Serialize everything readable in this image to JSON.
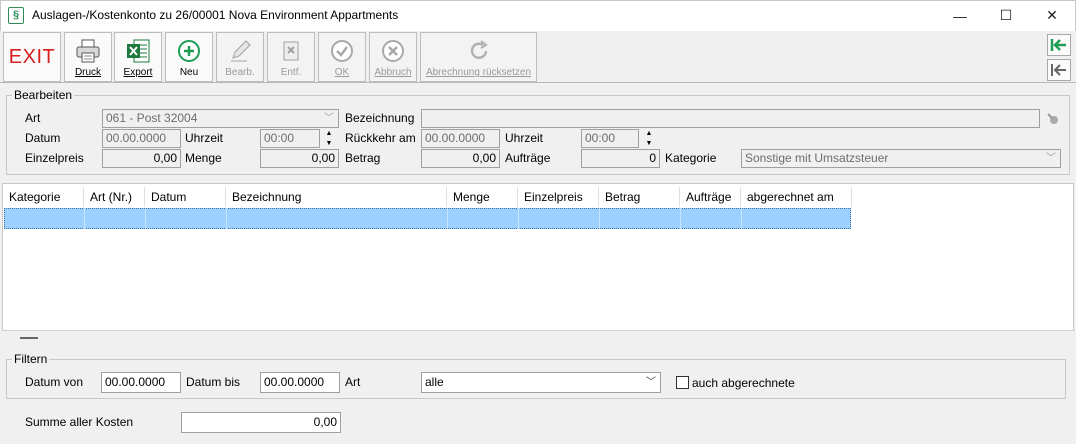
{
  "window": {
    "title": "Auslagen-/Kostenkonto zu 26/00001 Nova Environment Appartments",
    "minimize": "—",
    "maximize": "☐",
    "close": "✕"
  },
  "toolbar": {
    "exit": "EXIT",
    "druck": "Druck",
    "export": "Export",
    "neu": "Neu",
    "bearb": "Bearb.",
    "entf": "Entf.",
    "ok": "OK",
    "abbruch": "Abbruch",
    "reset": "Abrechnung rücksetzen"
  },
  "bearbeiten": {
    "group_label": "Bearbeiten",
    "art_label": "Art",
    "art_value": "061 - Post 32004",
    "bezeichnung_label": "Bezeichnung",
    "bezeichnung_value": "",
    "datum_label": "Datum",
    "datum_value": "00.00.0000",
    "uhrzeit_label": "Uhrzeit",
    "uhrzeit_value": "00:00",
    "rueckkehr_label": "Rückkehr am",
    "rueckkehr_value": "00.00.0000",
    "uhrzeit2_label": "Uhrzeit",
    "uhrzeit2_value": "00:00",
    "einzelpreis_label": "Einzelpreis",
    "einzelpreis_value": "0,00",
    "menge_label": "Menge",
    "menge_value": "0,00",
    "betrag_label": "Betrag",
    "betrag_value": "0,00",
    "auftraege_label": "Aufträge",
    "auftraege_value": "0",
    "kategorie_label": "Kategorie",
    "kategorie_value": "Sonstige mit Umsatzsteuer"
  },
  "table": {
    "columns": [
      "Kategorie",
      "Art (Nr.)",
      "Datum",
      "Bezeichnung",
      "Menge",
      "Einzelpreis",
      "Betrag",
      "Aufträge",
      "abgerechnet am"
    ]
  },
  "filter": {
    "group_label": "Filtern",
    "datum_von_label": "Datum von",
    "datum_von_value": "00.00.0000",
    "datum_bis_label": "Datum bis",
    "datum_bis_value": "00.00.0000",
    "art_label": "Art",
    "art_value": "alle",
    "auch_label": "auch abgerechnete"
  },
  "summe": {
    "label": "Summe aller Kosten",
    "value": "0,00"
  },
  "colors": {
    "exit": "#d81e1e",
    "selection": "#9bd0ff",
    "excel_green": "#1e7a3c",
    "nav_green": "#1f9d55"
  }
}
